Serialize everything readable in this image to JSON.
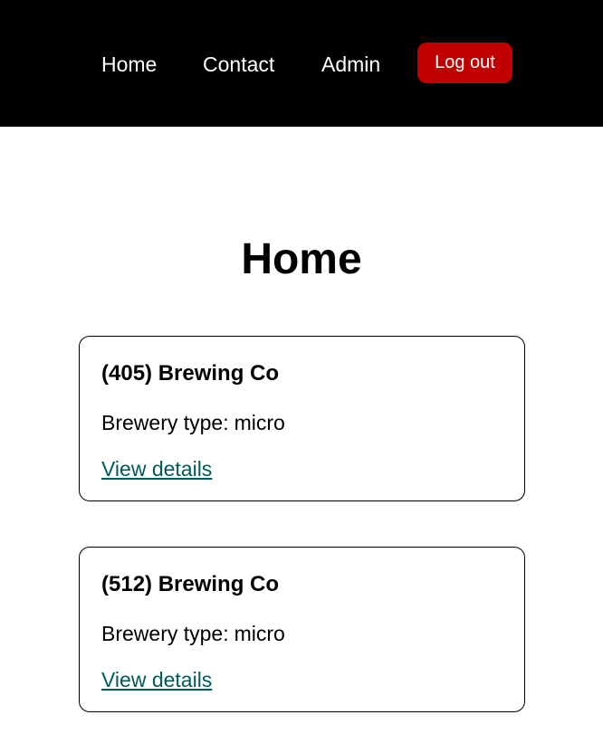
{
  "nav": {
    "items": [
      {
        "label": "Home"
      },
      {
        "label": "Contact"
      },
      {
        "label": "Admin"
      }
    ],
    "logout_label": "Log out"
  },
  "main": {
    "title": "Home",
    "breweries": [
      {
        "name": "(405) Brewing Co",
        "type_label": "Brewery type:",
        "type_value": "micro",
        "link_label": "View details"
      },
      {
        "name": "(512) Brewing Co",
        "type_label": "Brewery type:",
        "type_value": "micro",
        "link_label": "View details"
      }
    ]
  },
  "colors": {
    "nav_background": "#000000",
    "logout_button": "#c00000",
    "link": "#005a5a"
  }
}
